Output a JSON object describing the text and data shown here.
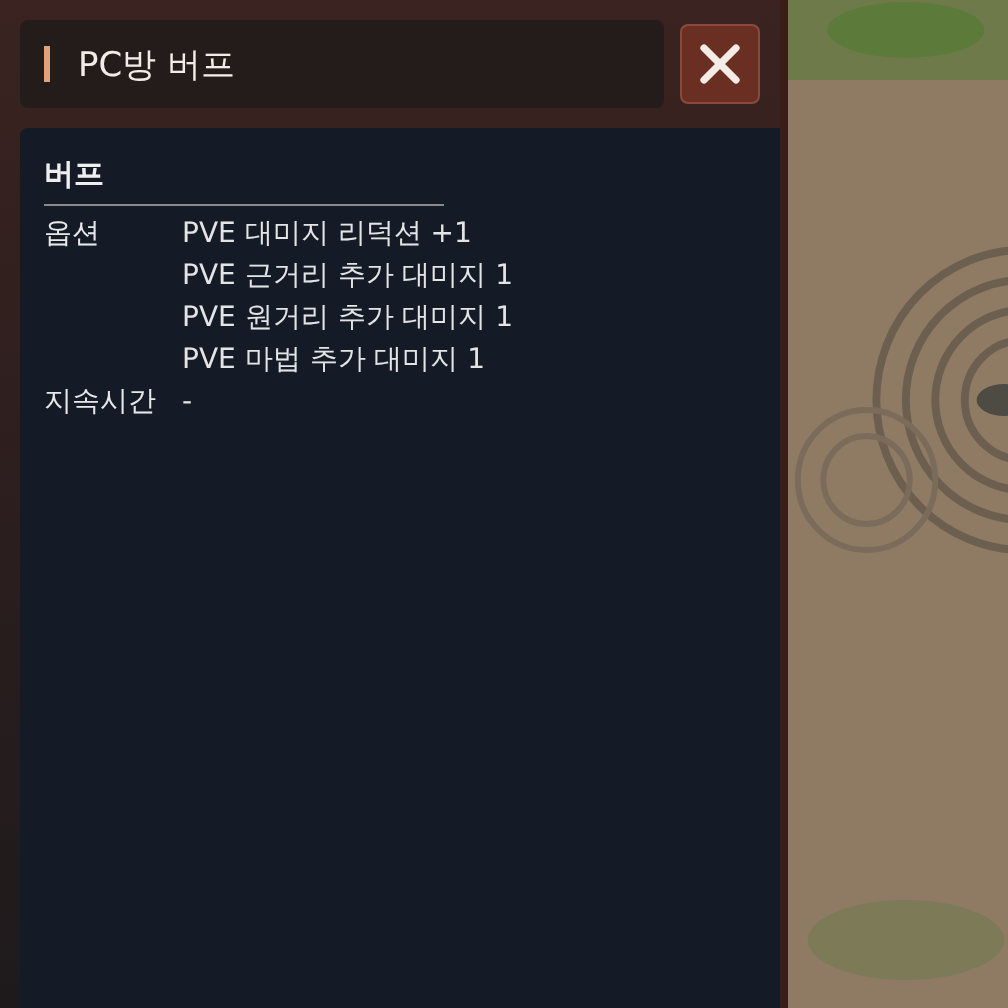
{
  "window": {
    "title": "PC방 버프"
  },
  "section": {
    "heading": "버프",
    "rows": [
      {
        "label": "옵션",
        "values": [
          "PVE 대미지 리덕션 +1",
          "PVE 근거리 추가 대미지 1",
          "PVE 원거리 추가 대미지 1",
          "PVE 마법 추가 대미지 1"
        ]
      },
      {
        "label": "지속시간",
        "values": [
          "-"
        ]
      }
    ]
  }
}
